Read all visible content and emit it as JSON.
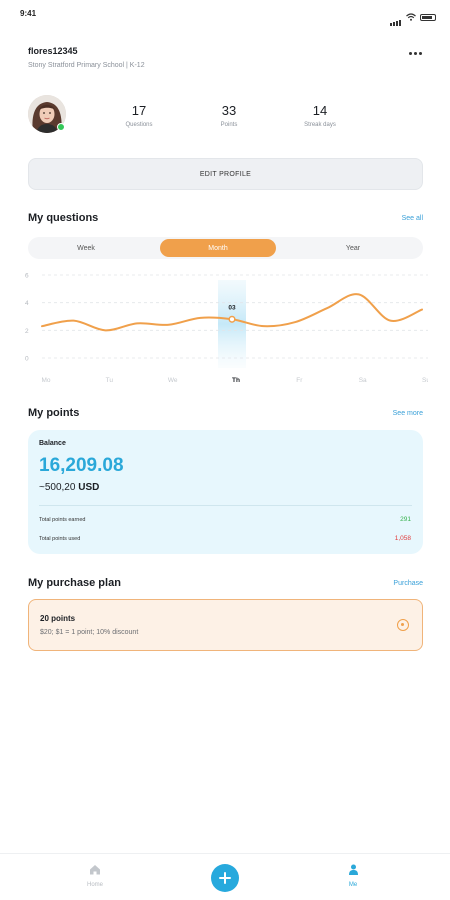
{
  "status_bar": {
    "time": "9:41"
  },
  "header": {
    "username": "flores12345",
    "school": "Stony Stratford Primary School | K-12"
  },
  "stats": [
    {
      "value": "17",
      "label": "Questions"
    },
    {
      "value": "33",
      "label": "Points"
    },
    {
      "value": "14",
      "label": "Streak days"
    }
  ],
  "edit_profile": {
    "label": "EDIT PROFILE"
  },
  "questions": {
    "title": "My questions",
    "link": "See all",
    "tabs": [
      "Week",
      "Month",
      "Year"
    ],
    "active_tab": "Month"
  },
  "chart_data": {
    "type": "line",
    "categories": [
      "Mo",
      "Tu",
      "We",
      "Th",
      "Fr",
      "Sa",
      "Su"
    ],
    "x": [
      0,
      0.5,
      1,
      1.5,
      2,
      2.5,
      3,
      3.5,
      4,
      4.5,
      5,
      5.5,
      6
    ],
    "values": [
      2.3,
      2.7,
      2.0,
      2.5,
      2.4,
      2.9,
      2.8,
      2.3,
      2.6,
      3.6,
      4.6,
      2.7,
      3.5
    ],
    "ylim": [
      0,
      6
    ],
    "yticks": [
      "0",
      "2",
      "4",
      "6"
    ],
    "highlight": {
      "category": "Th",
      "x": 3,
      "y": 2.8,
      "label": "03"
    },
    "grid": true,
    "color": "#f0a04b"
  },
  "points": {
    "title": "My points",
    "link": "See more",
    "balance_label": "Balance",
    "balance": "16,209.08",
    "usd_amount": "~500,20",
    "usd_unit": "USD",
    "earned_label": "Total points earned",
    "earned_value": "291",
    "used_label": "Total points used",
    "used_value": "1,058"
  },
  "purchase_plan": {
    "title": "My purchase plan",
    "link": "Purchase",
    "plan_title": "20 points",
    "plan_detail": "$20; $1 = 1 point; 10% discount"
  },
  "tabbar": {
    "home_label": "Home",
    "me_label": "Me"
  },
  "colors": {
    "accent_blue": "#2aa8d9",
    "accent_orange": "#f0a04b",
    "earned_green": "#37b24d",
    "used_red": "#e03b3b"
  }
}
